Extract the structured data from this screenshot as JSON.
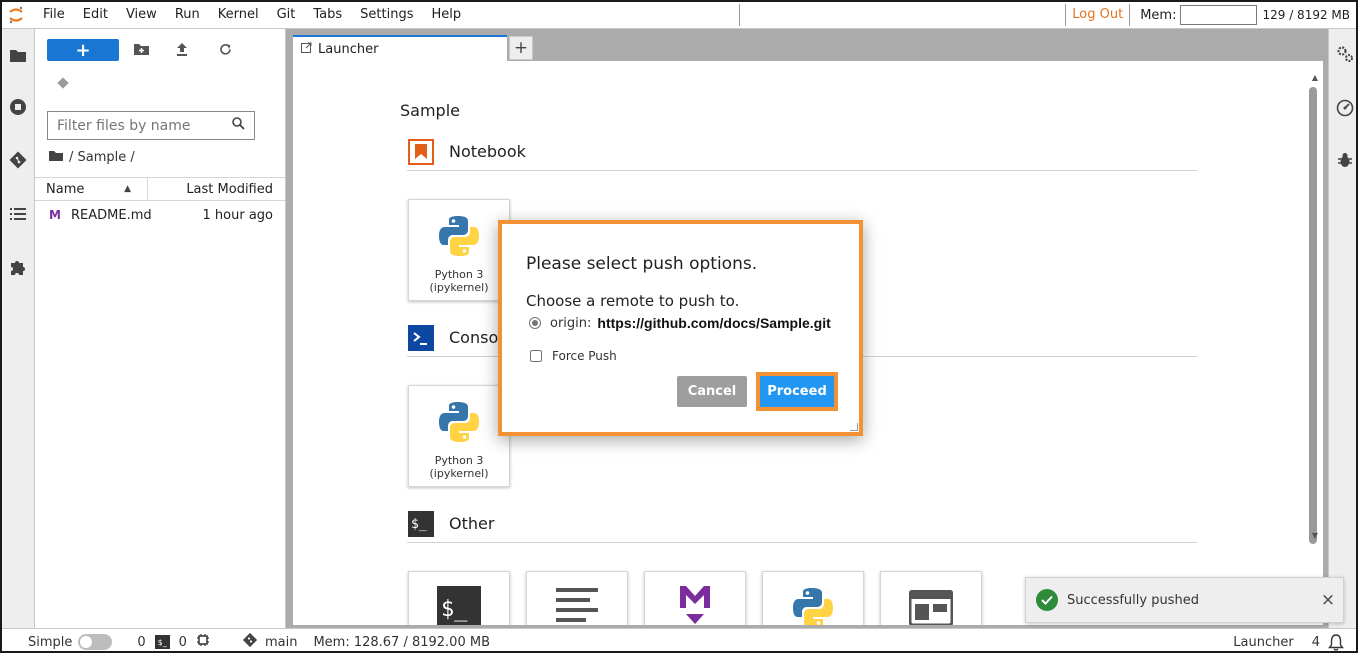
{
  "menubar": {
    "items": [
      "File",
      "Edit",
      "View",
      "Run",
      "Kernel",
      "Git",
      "Tabs",
      "Settings",
      "Help"
    ],
    "logout_label": "Log Out",
    "mem_label": "Mem:",
    "mem_value": "129 / 8192 MB"
  },
  "filebrowser": {
    "new_label": "+",
    "filter_placeholder": "Filter files by name",
    "breadcrumb": "/ Sample /",
    "columns": {
      "name": "Name",
      "modified": "Last Modified"
    },
    "files": [
      {
        "icon": "M",
        "name": "README.md",
        "modified": "1 hour ago"
      }
    ]
  },
  "tabs": [
    {
      "label": "Launcher"
    }
  ],
  "tab_add_label": "+",
  "launcher": {
    "title": "Sample",
    "sections": [
      {
        "label": "Notebook",
        "cards": [
          {
            "label": "Python 3 (ipykernel)"
          }
        ]
      },
      {
        "label": "Console",
        "cards": [
          {
            "label": "Python 3 (ipykernel)"
          }
        ]
      },
      {
        "label": "Other"
      }
    ]
  },
  "dialog": {
    "title": "Please select push options.",
    "subtitle": "Choose a remote to push to.",
    "remote_name": "origin:",
    "remote_url": "https://github.com/docs/Sample.git",
    "force_push_label": "Force Push",
    "cancel_label": "Cancel",
    "proceed_label": "Proceed"
  },
  "toast": {
    "message": "Successfully pushed",
    "close_glyph": "×"
  },
  "statusbar": {
    "simple_label": "Simple",
    "terminals_count": "0",
    "kernels_count": "0",
    "branch": "main",
    "mem": "Mem: 128.67 / 8192.00 MB",
    "mode": "Launcher",
    "notifications_count": "4"
  },
  "colors": {
    "accent_blue": "#1976d2",
    "proceed_blue": "#2196f3",
    "highlight_orange": "#f39234",
    "logout_orange": "#e37423",
    "success_green": "#2e8b3a"
  }
}
